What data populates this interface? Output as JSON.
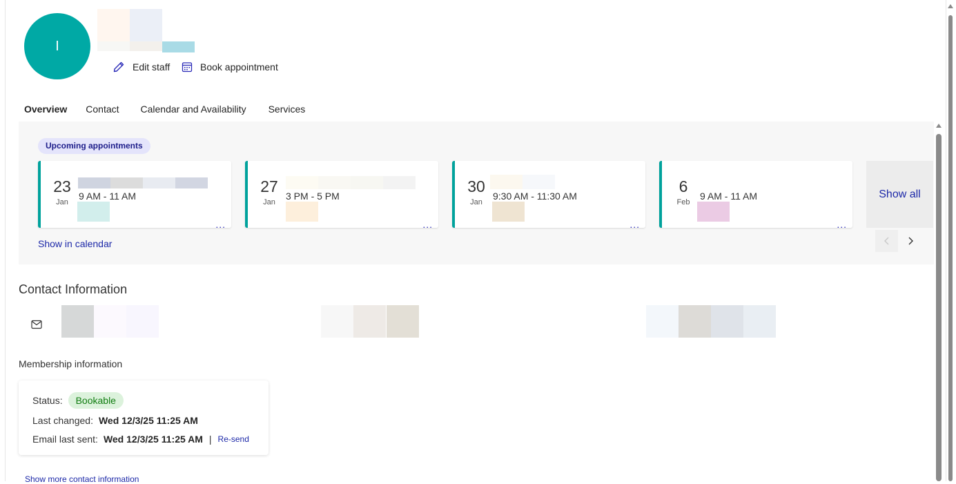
{
  "profile": {
    "initial": "I",
    "avatar_color": "#00a9a5",
    "actions": {
      "edit_staff": "Edit staff",
      "book_appointment": "Book appointment"
    }
  },
  "tabs": [
    {
      "label": "Overview",
      "active": true
    },
    {
      "label": "Contact",
      "active": false
    },
    {
      "label": "Calendar and Availability",
      "active": false
    },
    {
      "label": "Services",
      "active": false
    }
  ],
  "overview": {
    "badge": "Upcoming appointments",
    "appointments": [
      {
        "day": "23",
        "month": "Jan",
        "time": "9 AM - 11 AM"
      },
      {
        "day": "27",
        "month": "Jan",
        "time": "3 PM - 5 PM"
      },
      {
        "day": "30",
        "month": "Jan",
        "time": "9:30 AM - 11:30 AM"
      },
      {
        "day": "6",
        "month": "Feb",
        "time": "9 AM - 11 AM"
      }
    ],
    "more_glyph": "...",
    "show_all": "Show all",
    "show_in_calendar": "Show in calendar"
  },
  "contact": {
    "title": "Contact Information"
  },
  "membership": {
    "title": "Membership information",
    "status_label": "Status:",
    "status_value": "Bookable",
    "last_changed_label": "Last changed:",
    "last_changed_value": "Wed 12/3/25 11:25 AM",
    "email_sent_label": "Email last sent:",
    "email_sent_value": "Wed 12/3/25 11:25 AM",
    "separator": "|",
    "resend": "Re-send"
  },
  "show_more_contact": "Show more contact information",
  "colors": {
    "accent": "#00a29c",
    "link": "#1c28a8",
    "tab_underline": "#3b3ec4",
    "status_green": "#107c10"
  }
}
